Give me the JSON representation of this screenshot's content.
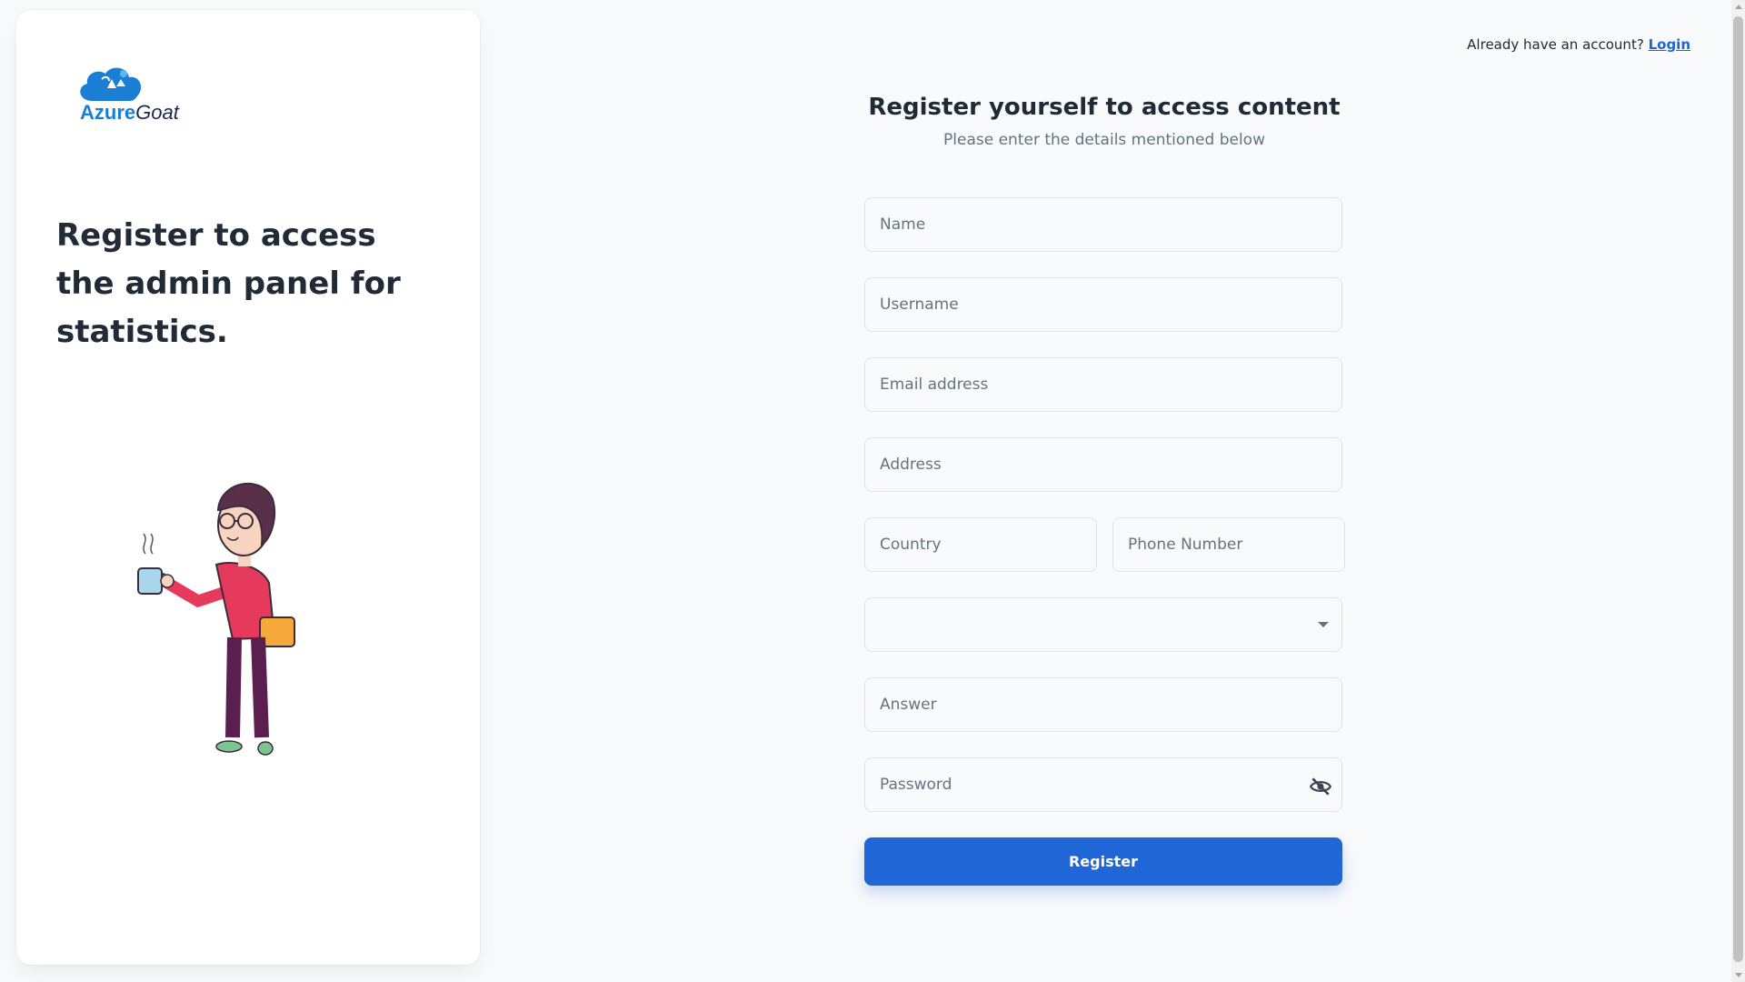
{
  "brand": {
    "logo_part1": "Azure",
    "logo_part2": "Goat",
    "logo_icon": "cloud-goat-icon",
    "primary_color": "#2166d6",
    "logo_color": "#1a7fd4"
  },
  "sidebar": {
    "heading": "Register to access the admin panel for statistics.",
    "illustration": "person-with-coffee-illustration"
  },
  "header": {
    "prompt": "Already have an account?",
    "login_link": "Login"
  },
  "form": {
    "title": "Register yourself to access content",
    "subtitle": "Please enter the details mentioned below",
    "fields": {
      "name": {
        "placeholder": "Name",
        "value": ""
      },
      "username": {
        "placeholder": "Username",
        "value": ""
      },
      "email": {
        "placeholder": "Email address",
        "value": ""
      },
      "address": {
        "placeholder": "Address",
        "value": ""
      },
      "country": {
        "placeholder": "Country",
        "value": ""
      },
      "phone": {
        "placeholder": "Phone Number",
        "value": ""
      },
      "security_question": {
        "value": "",
        "icon": "chevron-down-icon"
      },
      "answer": {
        "placeholder": "Answer",
        "value": ""
      },
      "password": {
        "placeholder": "Password",
        "value": "",
        "icon": "eye-off-icon"
      }
    },
    "submit_label": "Register"
  }
}
